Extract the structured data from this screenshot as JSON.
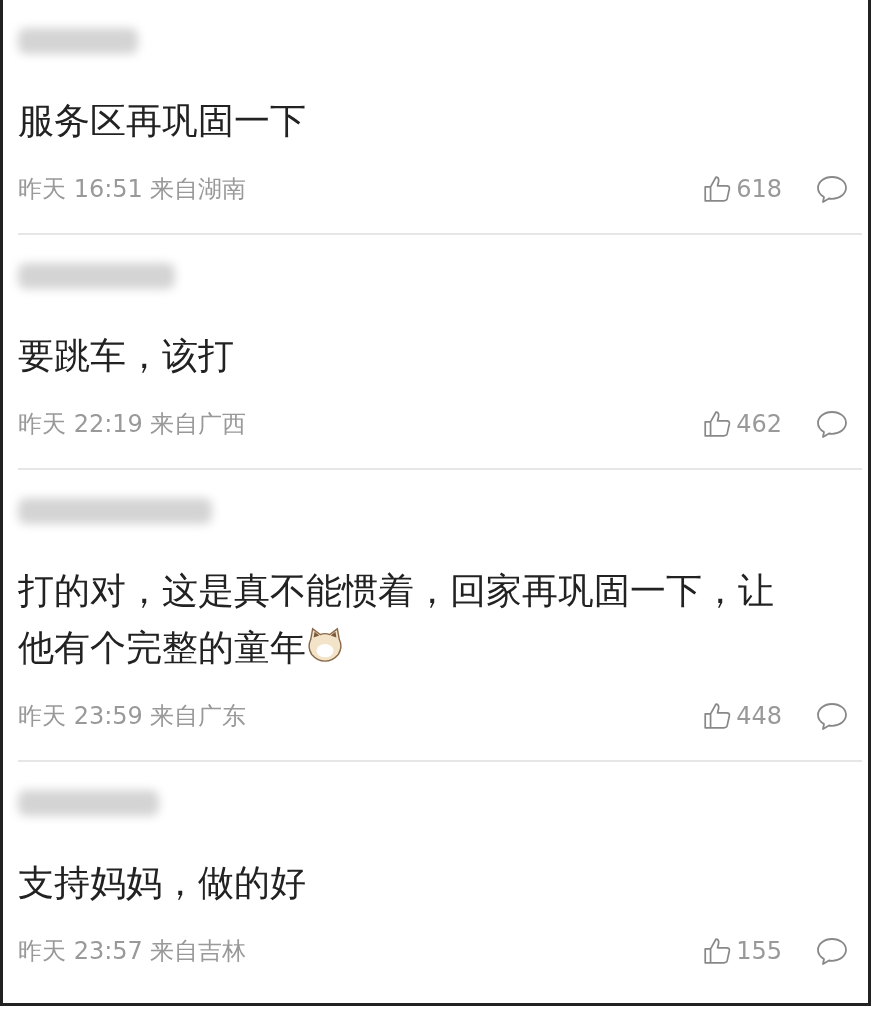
{
  "comments": [
    {
      "text": "服务区再巩固一下",
      "meta": "昨天 16:51 来自湖南",
      "likes": "618",
      "emoji": false
    },
    {
      "text": "要跳车，该打",
      "meta": "昨天 22:19 来自广西",
      "likes": "462",
      "emoji": false
    },
    {
      "text": "打的对，这是真不能惯着，回家再巩固一下，让他有个完整的童年",
      "meta": "昨天 23:59 来自广东",
      "likes": "448",
      "emoji": true
    },
    {
      "text": "支持妈妈，做的好",
      "meta": "昨天 23:57 来自吉林",
      "likes": "155",
      "emoji": false
    }
  ]
}
